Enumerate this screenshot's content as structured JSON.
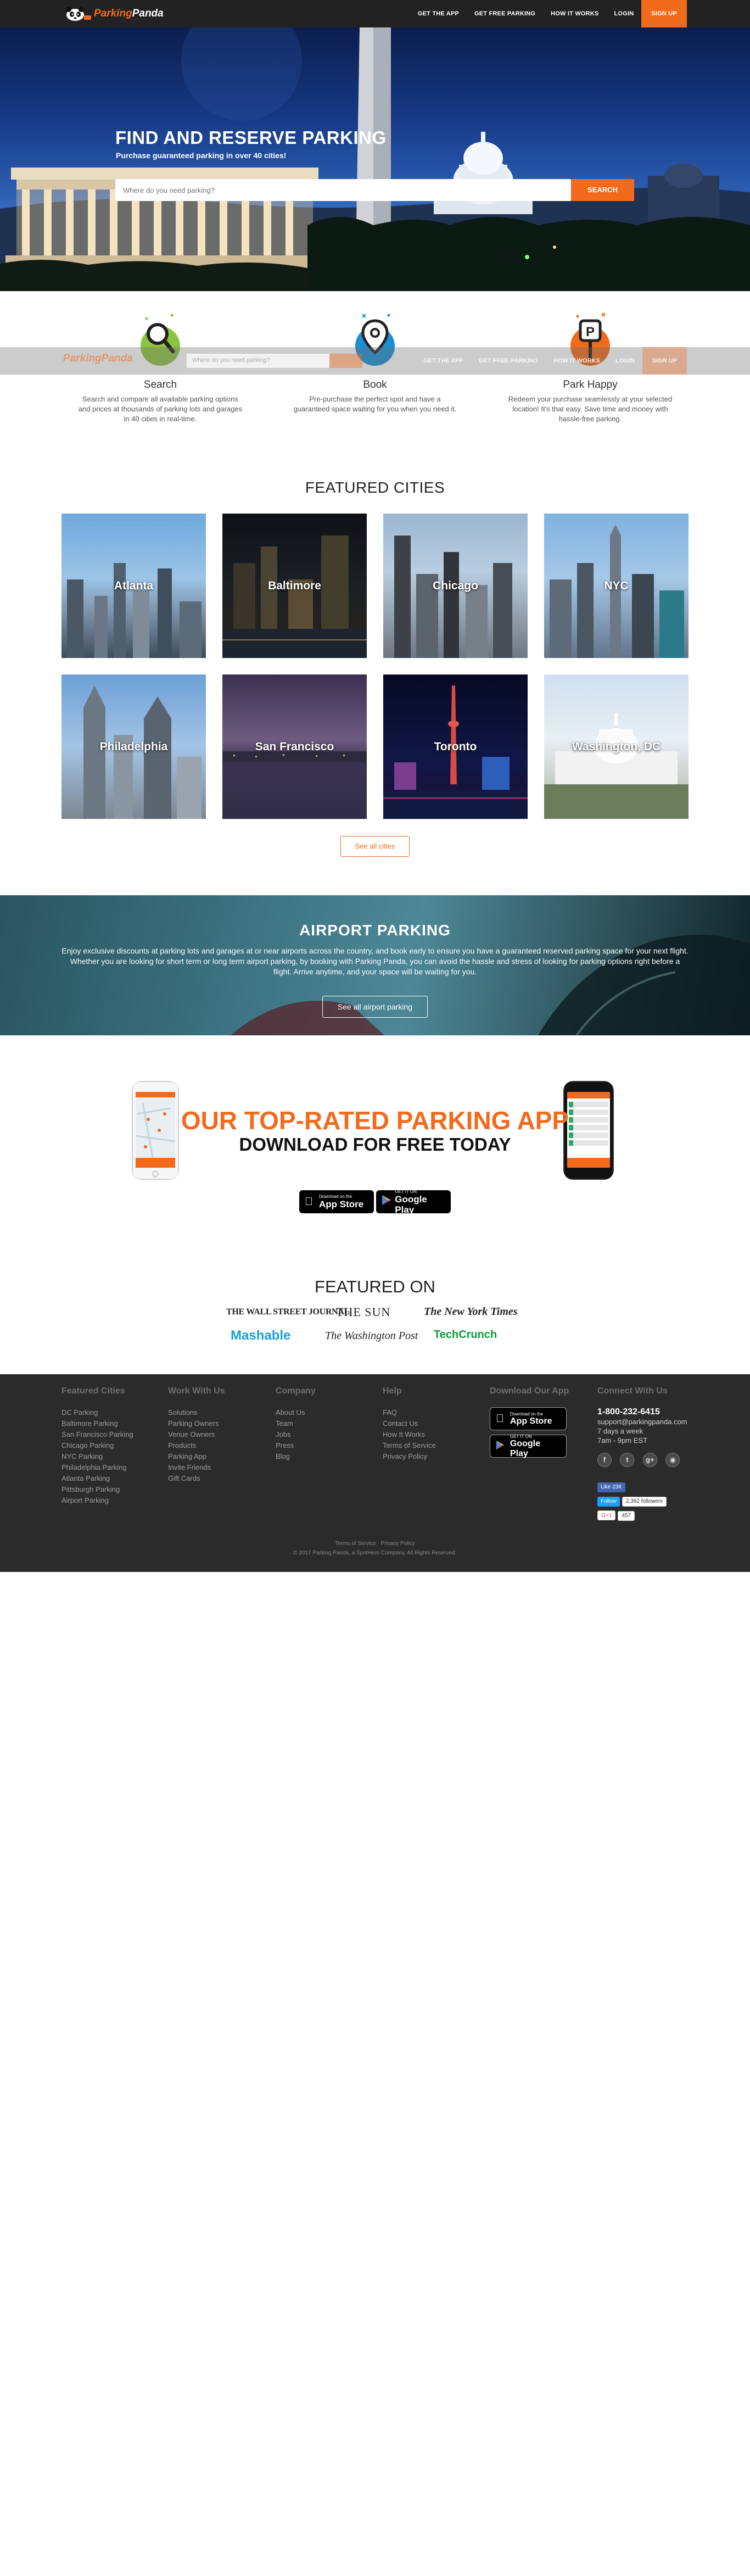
{
  "brand": {
    "name_part1": "Parking",
    "name_part2": "Panda"
  },
  "nav": {
    "links": [
      {
        "label": "GET THE APP"
      },
      {
        "label": "GET FREE PARKING"
      },
      {
        "label": "HOW IT WORKS"
      },
      {
        "label": "LOGIN"
      },
      {
        "label": "SIGN UP"
      }
    ]
  },
  "hero": {
    "title": "FIND AND RESERVE PARKING",
    "subtitle": "Purchase guaranteed parking in over 40 cities!",
    "search_placeholder": "Where do you need parking?",
    "search_button": "SEARCH"
  },
  "sticky_nav": {
    "search_placeholder": "Where do you need parking?"
  },
  "how_it_works": [
    {
      "title": "Search",
      "text": "Search and compare all available parking options and prices at thousands of parking lots and garages in 40 cities in real-time.",
      "icon": "magnifier-icon"
    },
    {
      "title": "Book",
      "text": "Pre-purchase the perfect spot and have a guaranteed space waiting for you when you need it.",
      "icon": "map-pin-icon"
    },
    {
      "title": "Park Happy",
      "text": "Redeem your purchase seamlessly at your selected location! It's that easy. Save time and money with hassle-free parking.",
      "icon": "parking-sign-icon"
    }
  ],
  "featured_cities": {
    "title": "FEATURED CITIES",
    "cities": [
      {
        "name": "Atlanta"
      },
      {
        "name": "Baltimore"
      },
      {
        "name": "Chicago"
      },
      {
        "name": "NYC"
      },
      {
        "name": "Philadelphia"
      },
      {
        "name": "San Francisco"
      },
      {
        "name": "Toronto"
      },
      {
        "name": "Washington, DC"
      }
    ],
    "see_all": "See all cities"
  },
  "airport": {
    "title": "AIRPORT PARKING",
    "text": "Enjoy exclusive discounts at parking lots and garages at or near airports across the country, and book early to ensure you have a guaranteed reserved parking space for your next flight. Whether you are looking for short term or long term airport parking, by booking with Parking Panda, you can avoid the hassle and stress of looking for parking options right before a flight. Arrive anytime, and your space will be waiting for you.",
    "button": "See all airport parking"
  },
  "app_promo": {
    "title": "OUR TOP-RATED PARKING APP",
    "subtitle_pre": "DOWNLOAD FOR ",
    "subtitle_free": "FREE",
    "subtitle_post": " TODAY",
    "app_store_small": "Download on the",
    "app_store_big": "App Store",
    "google_small": "GET IT ON",
    "google_big": "Google Play"
  },
  "press": {
    "title": "FEATURED ON",
    "logos": [
      "THE WALL STREET JOURNAL.",
      "THE SUN",
      "The New York Times",
      "Mashable",
      "The Washington Post",
      "TechCrunch"
    ]
  },
  "footer": {
    "columns": [
      {
        "heading": "Featured Cities",
        "items": [
          "DC Parking",
          "Baltimore Parking",
          "San Francisco Parking",
          "Chicago Parking",
          "NYC Parking",
          "Philadelphia Parking",
          "Atlanta Parking",
          "Pittsburgh Parking",
          "Airport Parking"
        ]
      },
      {
        "heading": "Work With Us",
        "items": [
          "Solutions",
          "Parking Owners",
          "Venue Owners",
          "Products",
          "Parking App",
          "Invite Friends",
          "Gift Cards"
        ]
      },
      {
        "heading": "Company",
        "items": [
          "About Us",
          "Team",
          "Jobs",
          "Press",
          "Blog"
        ]
      },
      {
        "heading": "Help",
        "items": [
          "FAQ",
          "Contact Us",
          "How It Works",
          "Terms of Service",
          "Privacy Policy"
        ]
      }
    ],
    "download_heading": "Download Our App",
    "connect_heading": "Connect With Us",
    "phone": "1-800-232-6415",
    "email": "support@parkingpanda.com",
    "days": "7 days a week",
    "hours": "7am - 9pm EST",
    "social_icons": [
      "facebook-icon",
      "twitter-icon",
      "google-plus-icon",
      "instagram-icon"
    ],
    "like_label": "Like 23K",
    "follow_label": "Follow",
    "followers": "2,392 followers",
    "gplus_label": "G+1",
    "gplus_count": "457",
    "legal_links": "Terms of Service · Privacy Policy",
    "copyright": "© 2017 Parking Panda, a SpotHero Company. All Rights Reserved."
  }
}
